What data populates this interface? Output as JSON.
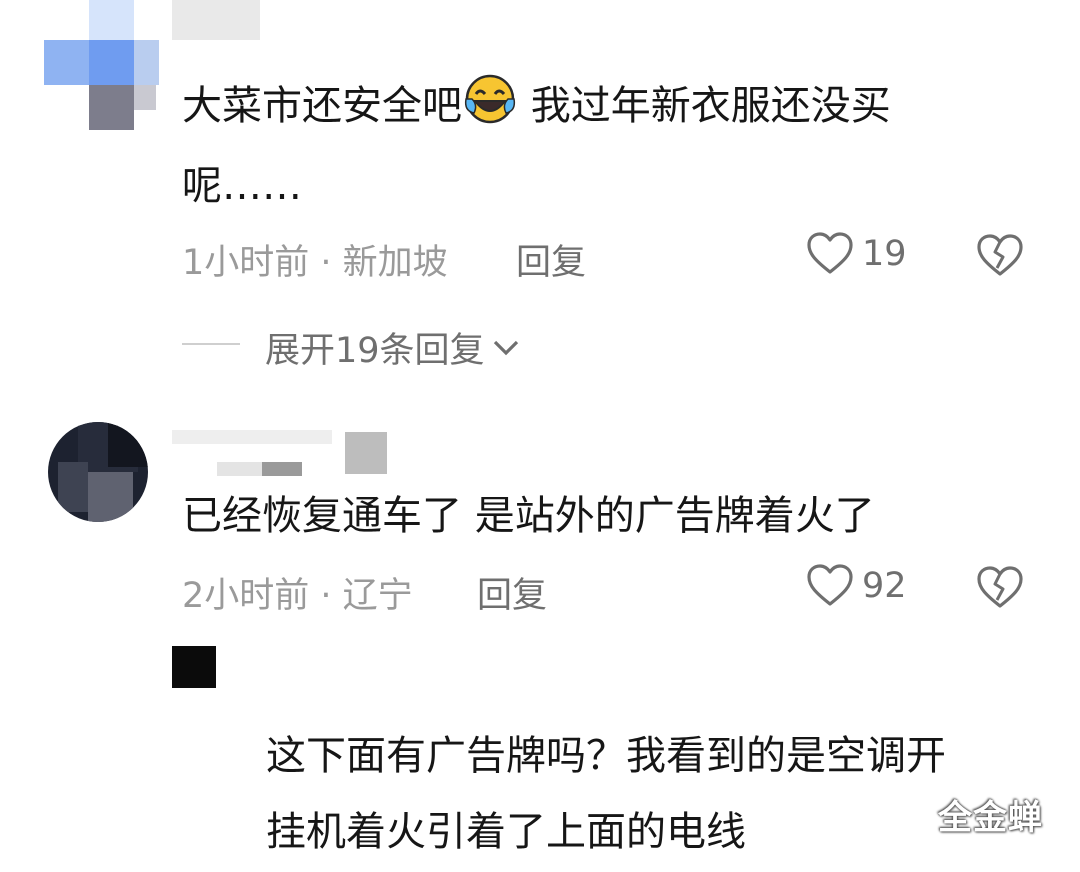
{
  "comments": [
    {
      "text": "大菜市还安全吧",
      "emoji": "🤣",
      "text_cont": " 我过年新衣服还没买",
      "text_line2": "呢……",
      "time_location": "1小时前 · 新加坡",
      "reply_label": "回复",
      "likes": "19",
      "expand_label": "展开19条回复"
    },
    {
      "text": "已经恢复通车了 是站外的广告牌着火了",
      "time_location": "2小时前 · 辽宁",
      "reply_label": "回复",
      "likes": "92"
    }
  ],
  "reply": {
    "line1": "这下面有广告牌吗？我看到的是空调开",
    "line2": "挂机着火引着了上面的电线"
  },
  "watermark": "全金蝉",
  "colors": {
    "text": "#161616",
    "meta": "#9a9a9a",
    "action": "#6f6f6f"
  },
  "icons": [
    "heart-icon",
    "broken-heart-icon",
    "chevron-down-icon",
    "laughing-emoji-icon"
  ]
}
